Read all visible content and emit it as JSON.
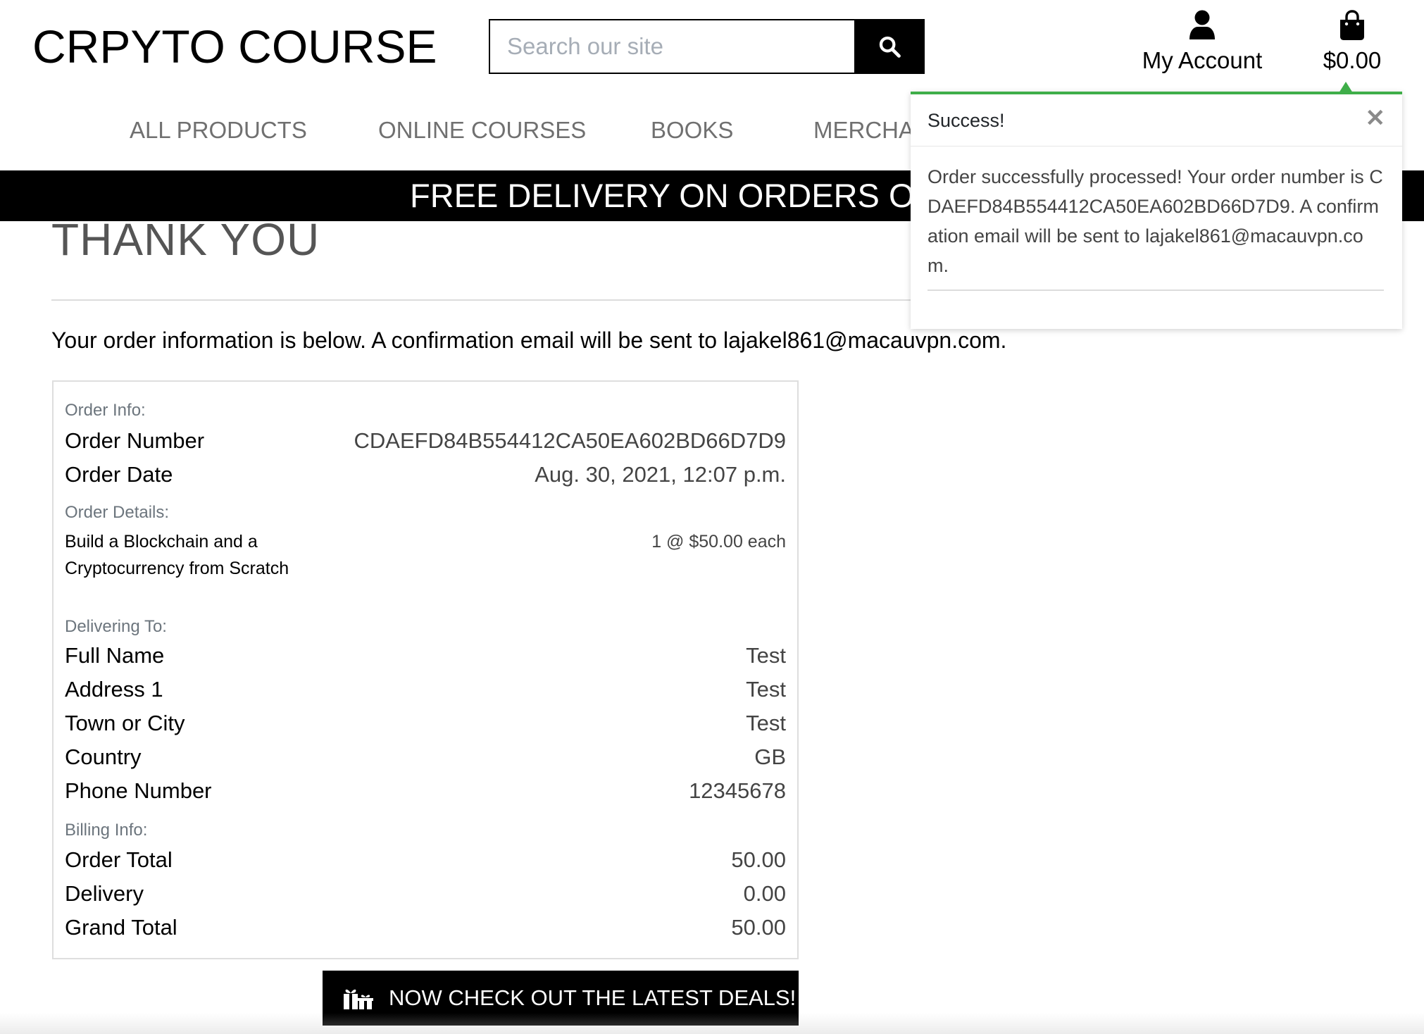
{
  "header": {
    "brand": "CRPYTO COURSE",
    "search_placeholder": "Search our site",
    "account_label": "My Account",
    "bag_total": "$0.00"
  },
  "nav": {
    "items": [
      {
        "label": "ALL PRODUCTS"
      },
      {
        "label": "ONLINE COURSES"
      },
      {
        "label": "BOOKS"
      },
      {
        "label": "MERCHANDISE"
      }
    ]
  },
  "banner": {
    "text": "FREE DELIVERY ON ORDERS OVER"
  },
  "main": {
    "title": "THANK YOU",
    "intro_prefix": "Your order information is below. A confirmation email will be sent to ",
    "email": "lajakel861@macauvpn.com",
    "intro_suffix": "."
  },
  "order": {
    "order_info_heading": "Order Info:",
    "order_number_label": "Order Number",
    "order_number": "CDAEFD84B554412CA50EA602BD66D7D9",
    "order_date_label": "Order Date",
    "order_date": "Aug. 30, 2021, 12:07 p.m.",
    "order_details_heading": "Order Details:",
    "item_name": "Build a Blockchain and a Cryptocurrency from Scratch",
    "item_qty": "1 @ $50.00 each",
    "delivering_heading": "Delivering To:",
    "full_name_label": "Full Name",
    "full_name": "Test",
    "address1_label": "Address 1",
    "address1": "Test",
    "town_label": "Town or City",
    "town": "Test",
    "country_label": "Country",
    "country": "GB",
    "phone_label": "Phone Number",
    "phone": "12345678",
    "billing_heading": "Billing Info:",
    "order_total_label": "Order Total",
    "order_total": "50.00",
    "delivery_label": "Delivery",
    "delivery": "0.00",
    "grand_total_label": "Grand Total",
    "grand_total": "50.00"
  },
  "cta": {
    "label": "NOW CHECK OUT THE LATEST DEALS!",
    "icon": "gifts-icon"
  },
  "toast": {
    "title": "Success!",
    "message": "Order successfully processed! Your order number is CDAEFD84B554412CA50EA602BD66D7D9. A confirmation email will be sent to lajakel861@macauvpn.com.",
    "accent_color": "#3fae49"
  },
  "icons": {
    "search": "search-icon",
    "account": "user-icon",
    "bag": "shopping-bag-icon",
    "close": "close-icon"
  }
}
